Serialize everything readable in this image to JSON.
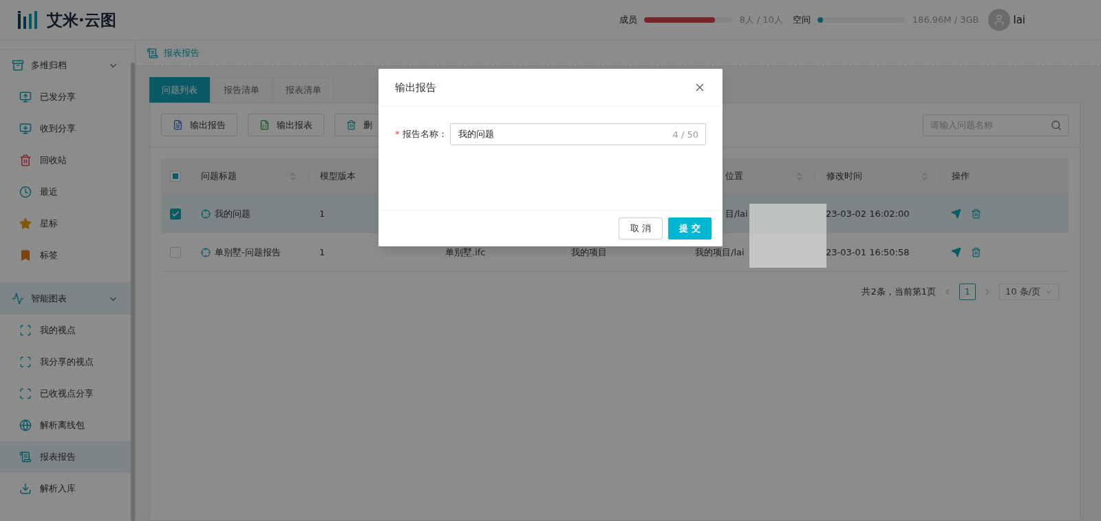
{
  "app": {
    "logo_text": "艾米·云图"
  },
  "usage": [
    {
      "label": "成员",
      "level": 0.8,
      "reading": "8人 / 10人",
      "kind": "members"
    },
    {
      "label": "空间",
      "level": 0.06,
      "reading": "186.96M / 3GB",
      "kind": "storage"
    }
  ],
  "user": {
    "name": "lai"
  },
  "sidebar": {
    "groups": [
      {
        "label": "多维归档",
        "kind": "archive",
        "expanded": true,
        "selected": false,
        "items": [
          {
            "label": "已发分享",
            "kind": "share-out",
            "selected": false
          },
          {
            "label": "收到分享",
            "kind": "share-in",
            "selected": false
          },
          {
            "label": "回收站",
            "kind": "trash",
            "selected": false
          },
          {
            "label": "最近",
            "kind": "recent",
            "selected": false
          },
          {
            "label": "星标",
            "kind": "star",
            "selected": false
          },
          {
            "label": "标签",
            "kind": "tag",
            "selected": false
          }
        ]
      },
      {
        "label": "智能图表",
        "kind": "chart",
        "expanded": true,
        "selected": true,
        "items": [
          {
            "label": "我的视点",
            "kind": "viewpoint",
            "selected": false
          },
          {
            "label": "我分享的视点",
            "kind": "viewpoint",
            "selected": false
          },
          {
            "label": "已收视点分享",
            "kind": "viewpoint",
            "selected": false
          },
          {
            "label": "解析离线包",
            "kind": "globe",
            "selected": false
          },
          {
            "label": "报表报告",
            "kind": "report",
            "selected": true
          },
          {
            "label": "解析入库",
            "kind": "import",
            "selected": false
          }
        ]
      }
    ]
  },
  "breadcrumb": "报表报告",
  "tabs": [
    {
      "label": "问题列表",
      "selected": true
    },
    {
      "label": "报告清单",
      "selected": false
    },
    {
      "label": "报表清单",
      "selected": false
    }
  ],
  "toolbar": [
    {
      "label": "输出报告",
      "kind": "word"
    },
    {
      "label": "输出报表",
      "kind": "excel"
    },
    {
      "label": "删",
      "kind": "delete"
    }
  ],
  "search": {
    "placeholder": "请输入问题名称"
  },
  "table": {
    "header_indeterminate": true,
    "columns": [
      {
        "kind": "text",
        "label": "问题标题",
        "sortable": true
      },
      {
        "kind": "text",
        "label": "模型版本",
        "sortable": false
      },
      {
        "kind": "hidden"
      },
      {
        "kind": "hidden"
      },
      {
        "kind": "clipped",
        "label": "位置",
        "sortable": true
      },
      {
        "kind": "text",
        "label": "修改时间",
        "sortable": true
      },
      {
        "kind": "text",
        "label": "操作",
        "sortable": false
      }
    ],
    "rows": [
      {
        "selected": true,
        "cells": [
          "我的问题",
          "1",
          null,
          null,
          {
            "kind": "clipped",
            "text": "目/lai"
          },
          "23-03-02 16:02:00"
        ]
      },
      {
        "selected": false,
        "cells": [
          "单别墅-问题报告",
          "1",
          "单别墅.ifc",
          "我的项目",
          "我的项目/lai",
          "23-03-01 16:50:58"
        ]
      }
    ]
  },
  "pagination": {
    "summary": "共2条，当前第1页",
    "pages": [
      {
        "label": "1",
        "selected": true
      }
    ],
    "page_size": "10 条/页"
  },
  "modal": {
    "title": "输出报告",
    "field": {
      "label": "报告名称：",
      "required_mark": "*",
      "value": "我的问题",
      "counter": "4 / 50"
    },
    "buttons": [
      {
        "label": "取 消",
        "kind": "default"
      },
      {
        "label": "提 交",
        "kind": "primary"
      }
    ]
  }
}
